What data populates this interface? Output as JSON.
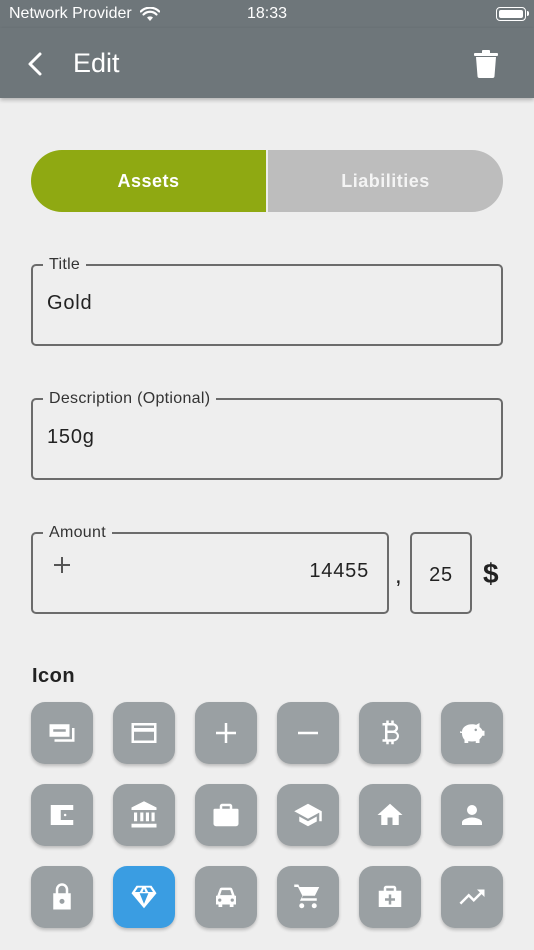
{
  "status_bar": {
    "carrier": "Network Provider",
    "time": "18:33"
  },
  "app_bar": {
    "title": "Edit"
  },
  "segments": [
    {
      "label": "Assets",
      "selected": true
    },
    {
      "label": "Liabilities",
      "selected": false
    }
  ],
  "colors": {
    "accent": "#8fa912",
    "selected_icon": "#3a9de2",
    "app_bar": "#6e767a"
  },
  "title_field": {
    "label": "Title",
    "value": "Gold"
  },
  "description_field": {
    "label": "Description (Optional)",
    "value": "150g"
  },
  "amount_field": {
    "label": "Amount",
    "value": "14455",
    "separator": ",",
    "cents": "25",
    "currency": "$"
  },
  "icon_section": {
    "label": "Icon"
  },
  "icons": [
    "cash-icon",
    "credit-card-icon",
    "plus-icon",
    "minus-icon",
    "bitcoin-icon",
    "piggy-bank-icon",
    "wallet-icon",
    "bank-icon",
    "briefcase-icon",
    "graduation-cap-icon",
    "house-icon",
    "person-icon",
    "lock-icon",
    "diamond-icon",
    "car-icon",
    "cart-icon",
    "medical-case-icon",
    "trending-up-icon"
  ],
  "selected_icon": "diamond-icon"
}
